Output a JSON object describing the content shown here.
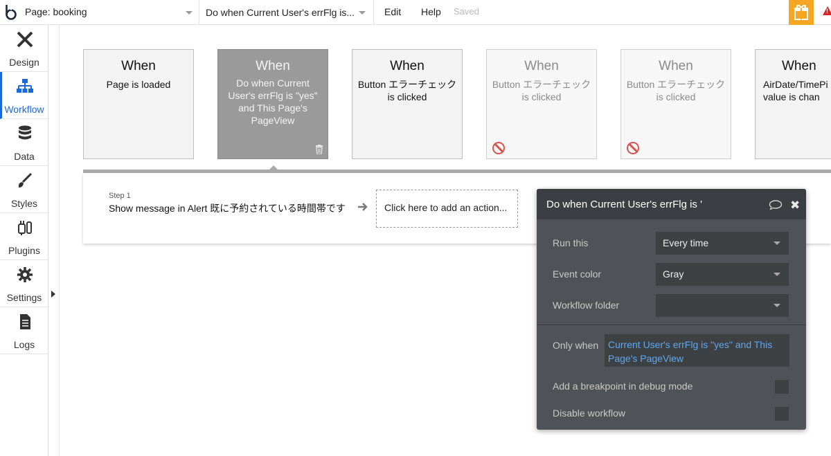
{
  "topbar": {
    "page_label": "Page: booking",
    "workflow_label": "Do when Current User's errFlg is...",
    "menu_edit": "Edit",
    "menu_help": "Help",
    "status": "Saved",
    "gift_color": "#f5a623",
    "alert_color": "#e02020"
  },
  "sidebar": {
    "items": [
      {
        "label": "Design",
        "icon": "design-icon"
      },
      {
        "label": "Workflow",
        "icon": "workflow-icon"
      },
      {
        "label": "Data",
        "icon": "data-icon"
      },
      {
        "label": "Styles",
        "icon": "styles-icon"
      },
      {
        "label": "Plugins",
        "icon": "plugins-icon"
      },
      {
        "label": "Settings",
        "icon": "settings-icon"
      },
      {
        "label": "Logs",
        "icon": "logs-icon"
      }
    ],
    "active_color": "#1b68d9"
  },
  "events": [
    {
      "when": "When",
      "desc": "Page is loaded",
      "state": "normal"
    },
    {
      "when": "When",
      "desc": "Do when Current User's errFlg is \"yes\" and This Page's PageView",
      "state": "selected"
    },
    {
      "when": "When",
      "desc": "Button エラーチェック is clicked",
      "state": "normal"
    },
    {
      "when": "When",
      "desc": "Button エラーチェック is clicked",
      "state": "disabled"
    },
    {
      "when": "When",
      "desc": "Button エラーチェック is clicked",
      "state": "disabled"
    },
    {
      "when": "When",
      "desc": "AirDate/TimePi value is chan",
      "state": "normal"
    }
  ],
  "step": {
    "label": "Step 1",
    "text": "Show message in Alert 既に予約されている時間帯です",
    "add_action": "Click here to add an action..."
  },
  "popup": {
    "title": "Do when Current User's errFlg is '",
    "run_this_label": "Run this",
    "run_this_value": "Every time",
    "event_color_label": "Event color",
    "event_color_value": "Gray",
    "folder_label": "Workflow folder",
    "folder_value": "",
    "only_when_label": "Only when",
    "only_when_value": "Current User's errFlg is \"yes\" and This Page's PageView",
    "breakpoint_label": "Add a breakpoint in debug mode",
    "disable_label": "Disable workflow",
    "condition_color": "#5fa8f0"
  }
}
